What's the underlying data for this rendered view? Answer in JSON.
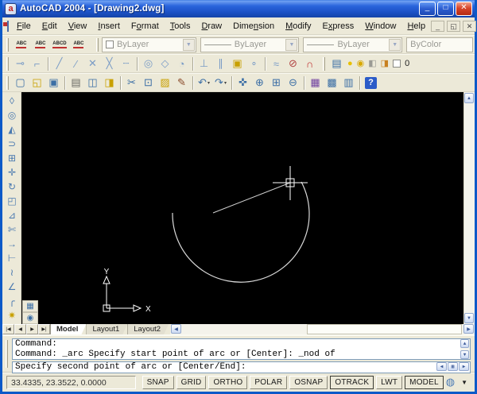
{
  "window": {
    "title": "AutoCAD 2004 - [Drawing2.dwg]",
    "controls": [
      {
        "name": "minimize",
        "glyph": "_"
      },
      {
        "name": "maximize",
        "glyph": "□"
      },
      {
        "name": "close",
        "glyph": "✕"
      }
    ]
  },
  "menu": {
    "items": [
      {
        "label": "File",
        "u": 0
      },
      {
        "label": "Edit",
        "u": 0
      },
      {
        "label": "View",
        "u": 0
      },
      {
        "label": "Insert",
        "u": 0
      },
      {
        "label": "Format",
        "u": 1
      },
      {
        "label": "Tools",
        "u": 0
      },
      {
        "label": "Draw",
        "u": 0
      },
      {
        "label": "Dimension",
        "u": 4
      },
      {
        "label": "Modify",
        "u": 0
      },
      {
        "label": "Express",
        "u": 1
      },
      {
        "label": "Window",
        "u": 0
      },
      {
        "label": "Help",
        "u": 0
      }
    ],
    "mdi_controls": [
      {
        "name": "minimize-document",
        "glyph": "_"
      },
      {
        "name": "restore-document",
        "glyph": "◱"
      },
      {
        "name": "close-document",
        "glyph": "✕"
      }
    ]
  },
  "text_toolbar": [
    {
      "name": "multiline-text",
      "glyph": "ABC"
    },
    {
      "name": "single-line-text",
      "glyph": "ABC"
    },
    {
      "name": "edit-text",
      "glyph": "ABCD"
    },
    {
      "name": "text-style",
      "glyph": "ABC"
    }
  ],
  "properties_toolbar": {
    "color": "ByLayer",
    "linetype": "ByLayer",
    "lineweight": "ByLayer",
    "plot_style": "ByColor"
  },
  "osnap_toolbar": [
    {
      "name": "temporary-track-point",
      "glyph": "⊸"
    },
    {
      "name": "snap-from",
      "glyph": "⌐"
    },
    {
      "name": "sep"
    },
    {
      "name": "snap-to-endpoint",
      "glyph": "╱"
    },
    {
      "name": "snap-to-midpoint",
      "glyph": "∕"
    },
    {
      "name": "snap-to-intersection",
      "glyph": "✕"
    },
    {
      "name": "snap-to-apparent-intersection",
      "glyph": "╳"
    },
    {
      "name": "snap-to-extension",
      "glyph": "┄"
    },
    {
      "name": "sep"
    },
    {
      "name": "snap-to-center",
      "glyph": "◎"
    },
    {
      "name": "snap-to-quadrant",
      "glyph": "◇"
    },
    {
      "name": "snap-to-tangent",
      "glyph": "◔"
    },
    {
      "name": "sep"
    },
    {
      "name": "snap-to-perpendicular",
      "glyph": "⊥"
    },
    {
      "name": "snap-to-parallel",
      "glyph": "∥"
    },
    {
      "name": "snap-to-insert",
      "glyph": "▣",
      "color": "#C8A000"
    },
    {
      "name": "snap-to-node",
      "glyph": "∘"
    },
    {
      "name": "sep"
    },
    {
      "name": "snap-to-nearest",
      "glyph": "≈"
    },
    {
      "name": "snap-to-none",
      "glyph": "⊘",
      "color": "#B04040"
    },
    {
      "name": "osnap-settings",
      "glyph": "∩",
      "color": "#C03030"
    }
  ],
  "layers_toolbar": {
    "manager_glyph": "▤",
    "status_icons": [
      {
        "name": "layer-on-icon",
        "glyph": "●",
        "color": "#E8C000"
      },
      {
        "name": "layer-thaw-icon",
        "glyph": "◉",
        "color": "#D8A800"
      },
      {
        "name": "layer-unlock-icon",
        "glyph": "◧",
        "color": "#9a9a94"
      },
      {
        "name": "layer-plot-icon",
        "glyph": "◨",
        "color": "#C88020"
      }
    ],
    "current_layer": "0"
  },
  "standard_toolbar": [
    {
      "name": "new",
      "glyph": "▢"
    },
    {
      "name": "open",
      "glyph": "◱",
      "color": "#C8A000"
    },
    {
      "name": "save",
      "glyph": "▣"
    },
    {
      "name": "sep"
    },
    {
      "name": "plot",
      "glyph": "▤",
      "color": "#6a6a64"
    },
    {
      "name": "plot-preview",
      "glyph": "◫"
    },
    {
      "name": "publish",
      "glyph": "◨",
      "color": "#C8A000"
    },
    {
      "name": "sep"
    },
    {
      "name": "cut",
      "glyph": "✂"
    },
    {
      "name": "copy",
      "glyph": "⊡"
    },
    {
      "name": "paste",
      "glyph": "▨",
      "color": "#C8A000"
    },
    {
      "name": "match-properties",
      "glyph": "✎",
      "color": "#8a4a2a"
    },
    {
      "name": "sep"
    },
    {
      "name": "undo",
      "glyph": "↶",
      "caret": true
    },
    {
      "name": "redo",
      "glyph": "↷",
      "caret": true
    },
    {
      "name": "sep"
    },
    {
      "name": "pan-realtime",
      "glyph": "✜"
    },
    {
      "name": "zoom-realtime",
      "glyph": "⊕"
    },
    {
      "name": "zoom-window",
      "glyph": "⊞"
    },
    {
      "name": "zoom-previous",
      "glyph": "⊖"
    },
    {
      "name": "sep"
    },
    {
      "name": "properties-palette",
      "glyph": "▦",
      "color": "#7040A0"
    },
    {
      "name": "designcenter",
      "glyph": "▩"
    },
    {
      "name": "tool-palettes",
      "glyph": "▥"
    },
    {
      "name": "sep"
    },
    {
      "name": "help",
      "glyph": "?",
      "help": true
    }
  ],
  "modify_toolbar": [
    {
      "name": "erase",
      "glyph": "◊"
    },
    {
      "name": "copy-object",
      "glyph": "◎"
    },
    {
      "name": "mirror",
      "glyph": "◭"
    },
    {
      "name": "offset",
      "glyph": "⊃"
    },
    {
      "name": "array",
      "glyph": "⊞"
    },
    {
      "name": "move",
      "glyph": "✛"
    },
    {
      "name": "rotate",
      "glyph": "↻"
    },
    {
      "name": "scale",
      "glyph": "◰"
    },
    {
      "name": "stretch",
      "glyph": "⊿"
    },
    {
      "name": "trim",
      "glyph": "✄"
    },
    {
      "name": "extend",
      "glyph": "→"
    },
    {
      "name": "break-at-point",
      "glyph": "⊢"
    },
    {
      "name": "break",
      "glyph": "≀"
    },
    {
      "name": "chamfer",
      "glyph": "∠"
    },
    {
      "name": "fillet",
      "glyph": "╭"
    },
    {
      "name": "explode",
      "glyph": "✷",
      "color": "#C8A000"
    }
  ],
  "draw_mini_toolbar": [
    {
      "name": "hatch",
      "glyph": "▦"
    },
    {
      "name": "region",
      "glyph": "◉"
    }
  ],
  "canvas": {
    "ucs_x_label": "X",
    "ucs_y_label": "Y",
    "entity_color": "#E0E0E0",
    "cursor_color": "#FFFFFF"
  },
  "layout_tabs": {
    "nav": [
      {
        "name": "first-tab",
        "glyph": "|◀"
      },
      {
        "name": "previous-tab",
        "glyph": "◀"
      },
      {
        "name": "next-tab",
        "glyph": "▶"
      },
      {
        "name": "last-tab",
        "glyph": "▶|"
      }
    ],
    "tabs": [
      {
        "label": "Model",
        "active": true
      },
      {
        "label": "Layout1",
        "active": false
      },
      {
        "label": "Layout2",
        "active": false
      }
    ]
  },
  "command_window": {
    "history": [
      "Command:",
      "Command: _arc Specify start point of arc or [Center]: _nod of"
    ],
    "prompt": "Specify second point of arc or [Center/End]:"
  },
  "status_bar": {
    "coordinates": "33.4335, 23.3522, 0.0000",
    "toggles": [
      {
        "label": "SNAP",
        "pressed": false
      },
      {
        "label": "GRID",
        "pressed": false
      },
      {
        "label": "ORTHO",
        "pressed": false
      },
      {
        "label": "POLAR",
        "pressed": false
      },
      {
        "label": "OSNAP",
        "pressed": false
      },
      {
        "label": "OTRACK",
        "pressed": true
      },
      {
        "label": "LWT",
        "pressed": false
      },
      {
        "label": "MODEL",
        "pressed": true
      }
    ]
  }
}
